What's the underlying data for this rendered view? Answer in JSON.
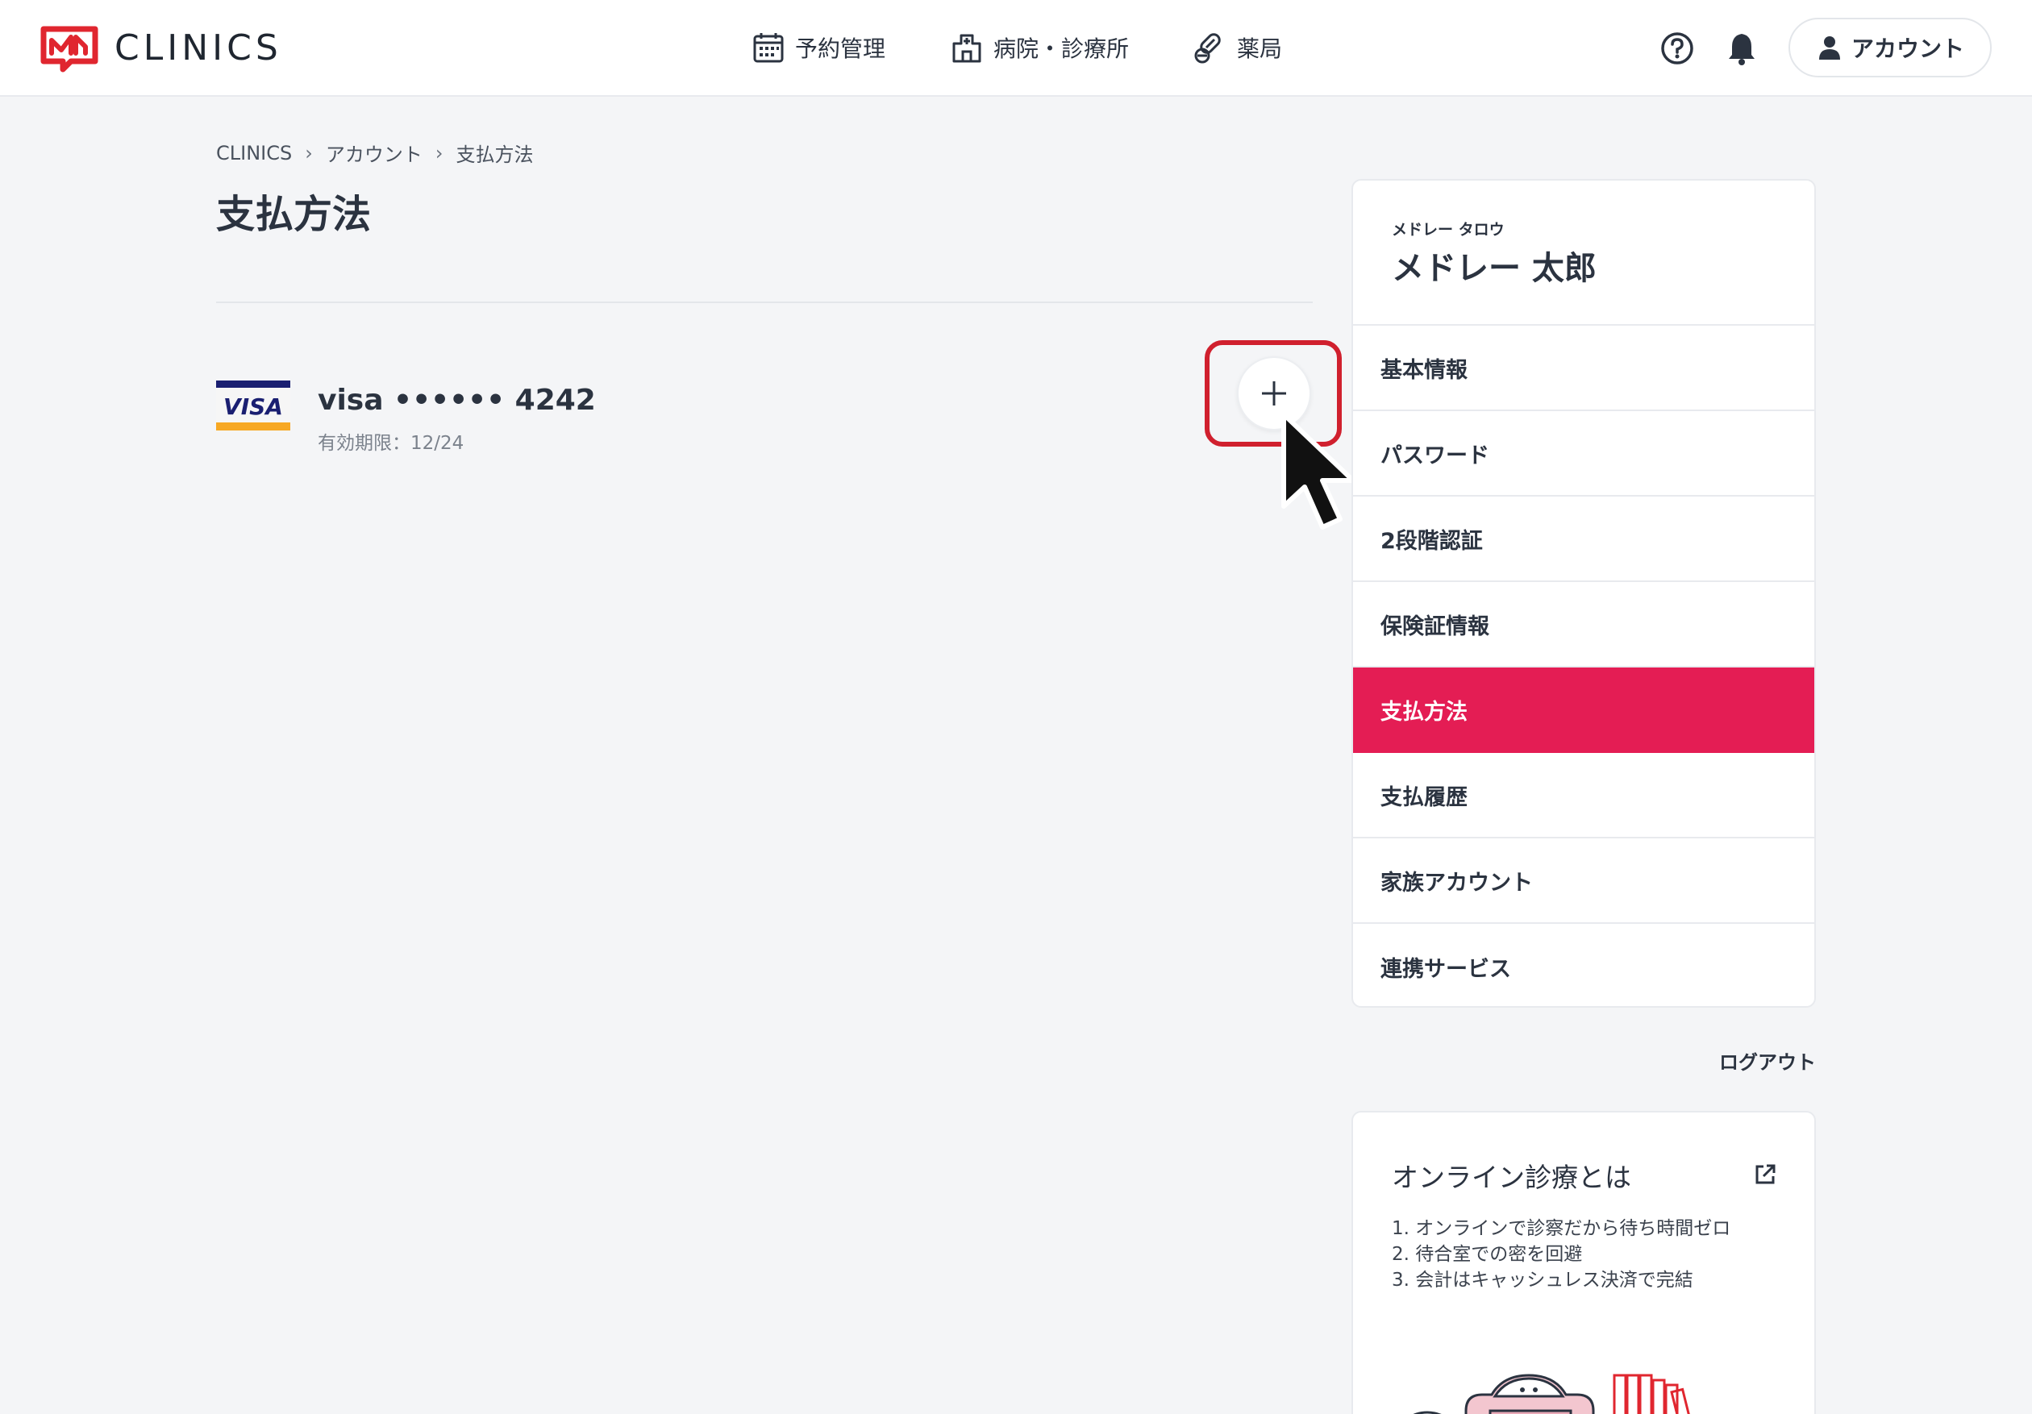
{
  "header": {
    "logo_text": "CLINICS",
    "nav": [
      {
        "label": "予約管理",
        "icon": "calendar-icon"
      },
      {
        "label": "病院・診療所",
        "icon": "hospital-icon"
      },
      {
        "label": "薬局",
        "icon": "pills-icon"
      }
    ],
    "help_icon": "help-icon",
    "bell_icon": "bell-icon",
    "account_label": "アカウント"
  },
  "breadcrumb": [
    "CLINICS",
    "アカウント",
    "支払方法"
  ],
  "page_title": "支払方法",
  "card": {
    "brand": "VISA",
    "number_text": "visa •••••• 4242",
    "expiry_text": "有効期限：12/24"
  },
  "sidebar": {
    "user_kana": "メドレー タロウ",
    "user_name": "メドレー 太郎",
    "items": [
      {
        "label": "基本情報",
        "active": false
      },
      {
        "label": "パスワード",
        "active": false
      },
      {
        "label": "2段階認証",
        "active": false
      },
      {
        "label": "保険証情報",
        "active": false
      },
      {
        "label": "支払方法",
        "active": true
      },
      {
        "label": "支払履歴",
        "active": false
      },
      {
        "label": "家族アカウント",
        "active": false
      },
      {
        "label": "連携サービス",
        "active": false
      }
    ],
    "logout_label": "ログアウト"
  },
  "info": {
    "title": "オンライン診療とは",
    "items": [
      "1. オンラインで診察だから待ち時間ゼロ",
      "2. 待合室での密を回避",
      "3. 会計はキャッシュレス決済で完結"
    ]
  },
  "colors": {
    "accent": "#e41d54",
    "highlight": "#d0202e",
    "brand_red": "#e0262f"
  }
}
